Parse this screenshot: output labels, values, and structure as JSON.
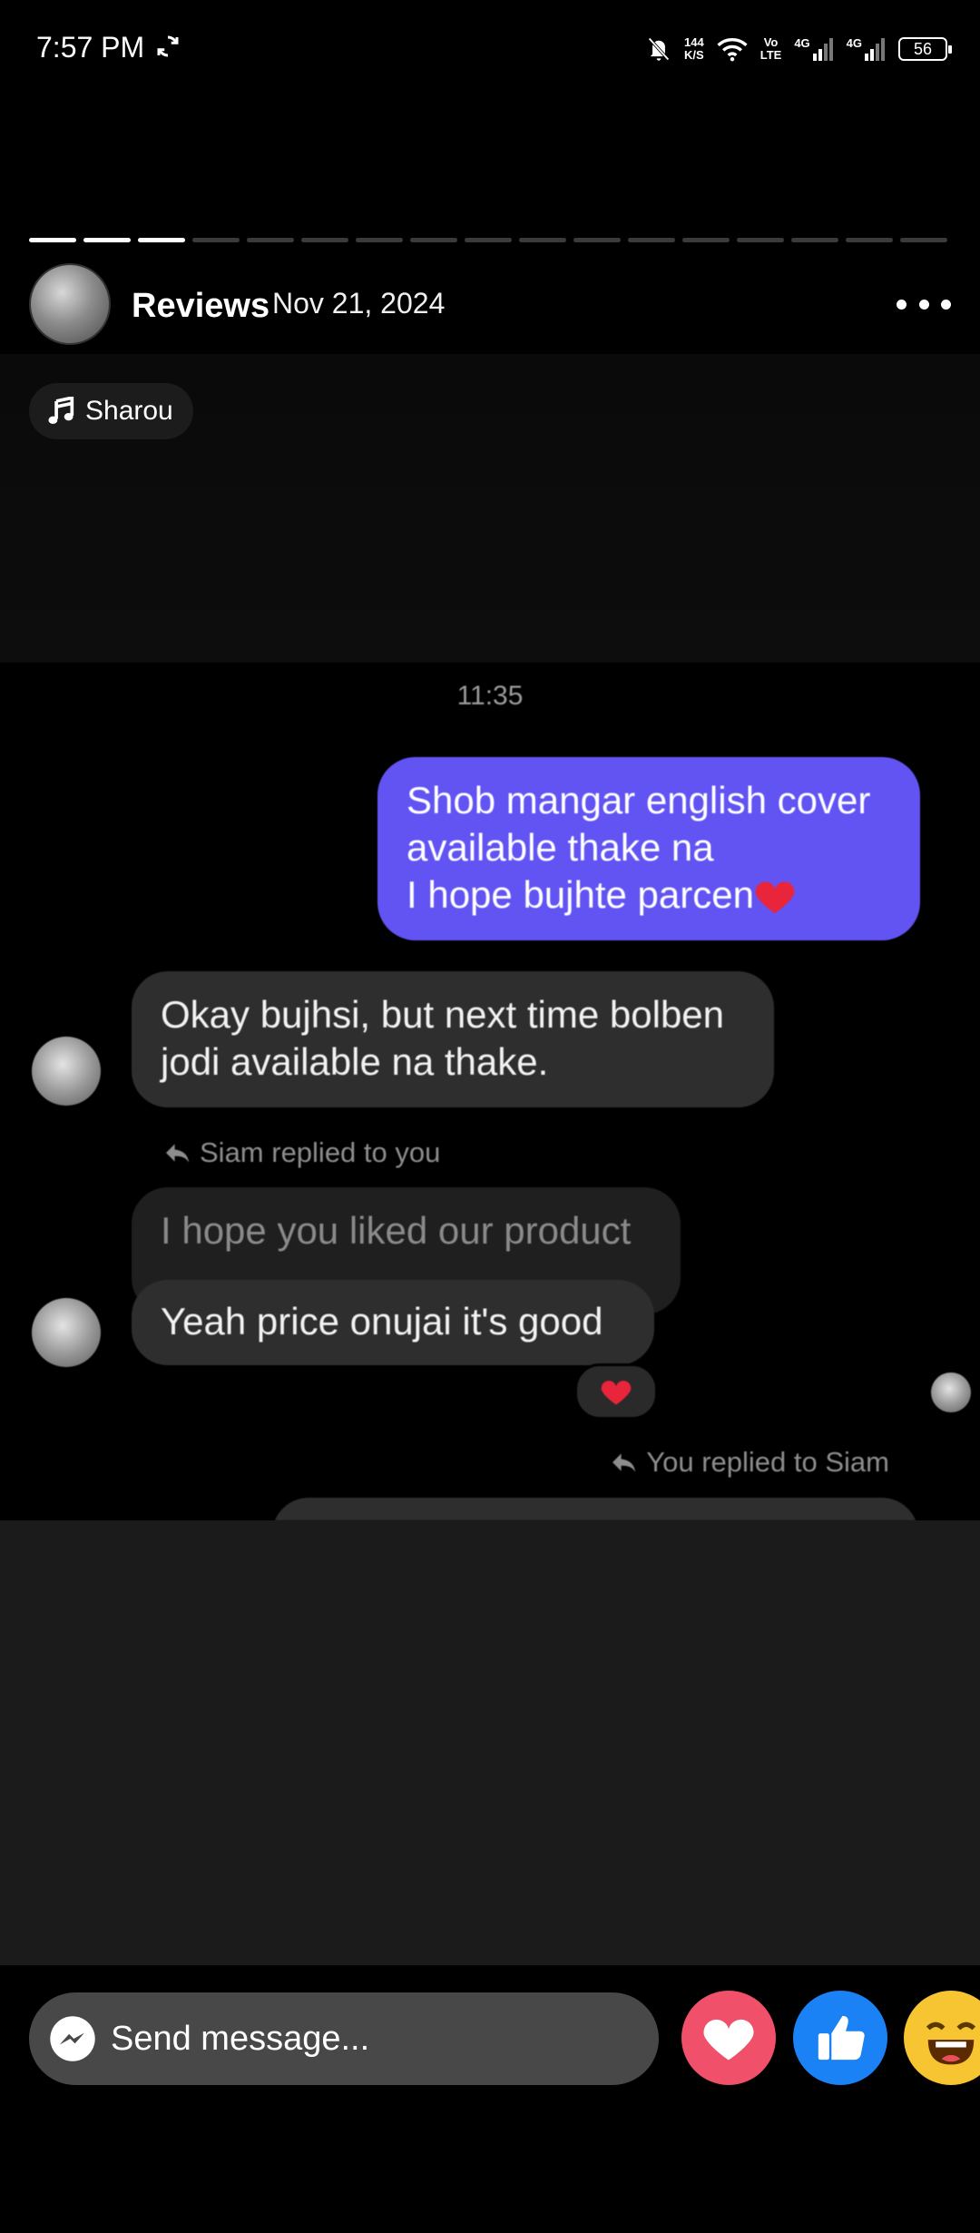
{
  "status_bar": {
    "time": "7:57 PM",
    "speed_value": "144",
    "speed_unit": "K/S",
    "volte_top": "Vo",
    "volte_bottom": "LTE",
    "network1": "4G",
    "network2": "4G",
    "battery": "56"
  },
  "story": {
    "progress": {
      "total_segments": 17,
      "completed_segments": 3
    },
    "title": "Reviews",
    "date": "Nov 21, 2024",
    "music_label": "Sharou"
  },
  "chat": {
    "timestamp": "11:35",
    "outgoing_message_lines": [
      "Shob mangar english cover",
      "available thake na",
      "I hope bujhte parcen"
    ],
    "incoming_message_1_lines": [
      "Okay bujhsi, but next time bolben",
      "jodi available na thake."
    ],
    "reply_label_1": "Siam replied to you",
    "quoted_message": "I hope you liked our product",
    "incoming_message_2": "Yeah price onujai it's good",
    "reply_label_2": "You replied to Siam"
  },
  "composer": {
    "placeholder": "Send message..."
  },
  "icons": {
    "sync": "sync-icon",
    "mute": "bell-off-icon",
    "wifi": "wifi-icon",
    "signal": "signal-icon",
    "music": "music-note-icon",
    "more": "more-icon",
    "reply": "reply-arrow-icon",
    "heart": "heart-icon",
    "messenger": "messenger-icon",
    "like": "thumbs-up-icon",
    "laugh": "laughing-face-icon"
  },
  "colors": {
    "outgoing_bubble": "#6254f2",
    "incoming_bubble": "#2e2e2e",
    "love_button": "#f0506a",
    "like_button": "#1a82f5",
    "laugh_button": "#f7c531"
  }
}
